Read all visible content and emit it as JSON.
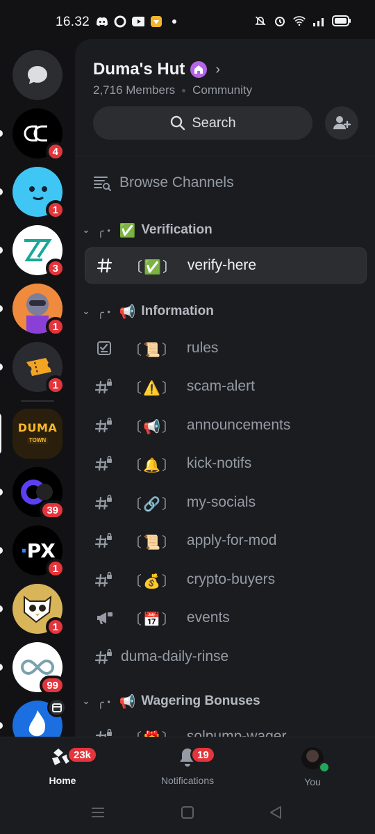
{
  "status_bar": {
    "time": "16.32"
  },
  "servers": [
    {
      "icon": "ac-logo",
      "badge": "4",
      "pill": true,
      "bg": "#000000"
    },
    {
      "icon": "blue-blob",
      "badge": "1",
      "pill": true,
      "bg": "#3fc6f4"
    },
    {
      "icon": "zr-logo",
      "badge": "3",
      "pill": true,
      "bg": "#ffffff"
    },
    {
      "icon": "raccoon-avatar",
      "badge": "1",
      "pill": true,
      "bg": "#f08a3c"
    },
    {
      "icon": "ticket-icon",
      "badge": "1",
      "pill": true,
      "bg": "#2a2b30"
    },
    {
      "icon": "duma-town-logo",
      "badge": "",
      "active": true,
      "bg": "#2a1f0c",
      "logo_text": "DUMA",
      "logo_sub": "TOWN"
    },
    {
      "icon": "ring-logo",
      "badge": "39",
      "pill": true,
      "bg": "#000000"
    },
    {
      "icon": "px-logo",
      "badge": "1",
      "pill": true,
      "bg": "#000000",
      "logo_text": "PX"
    },
    {
      "icon": "owl-logo",
      "badge": "1",
      "pill": true,
      "bg": "#d9b55a"
    },
    {
      "icon": "infinity-logo",
      "badge": "99",
      "pill": true,
      "bg": "#ffffff"
    },
    {
      "icon": "flame-logo",
      "badge": "",
      "pill": true,
      "bg": "#1b6fe0"
    }
  ],
  "server_header": {
    "name": "Duma's Hut",
    "members": "2,716 Members",
    "type": "Community",
    "search_label": "Search"
  },
  "browse_label": "Browse Channels",
  "categories": [
    {
      "deco": "╭・",
      "emoji": "✅",
      "name": "Verification"
    },
    {
      "deco": "╭・",
      "emoji": "📢",
      "name": "Information"
    },
    {
      "deco": "╭・",
      "emoji": "📢",
      "name": "Wagering Bonuses"
    }
  ],
  "channels": [
    {
      "icon": "hash",
      "emoji": "✅",
      "name": "verify-here",
      "active": true
    },
    {
      "icon": "rules",
      "emoji": "📜",
      "name": "rules"
    },
    {
      "icon": "hash-lock",
      "emoji": "⚠️",
      "name": "scam-alert"
    },
    {
      "icon": "hash-lock",
      "emoji": "📢",
      "name": "announcements"
    },
    {
      "icon": "hash-lock",
      "emoji": "🔔",
      "name": "kick-notifs"
    },
    {
      "icon": "hash-lock",
      "emoji": "🔗",
      "name": "my-socials"
    },
    {
      "icon": "hash-lock",
      "emoji": "📜",
      "name": "apply-for-mod"
    },
    {
      "icon": "hash-lock",
      "emoji": "💰",
      "name": "crypto-buyers"
    },
    {
      "icon": "megaphone-lock",
      "emoji": "📅",
      "name": "events"
    },
    {
      "icon": "hash-lock",
      "emoji": "",
      "name": "duma-daily-rinse"
    },
    {
      "icon": "hash-lock",
      "emoji": "🎁",
      "name": "solpump-wager"
    }
  ],
  "bottom_nav": {
    "home": {
      "label": "Home",
      "badge": "23k"
    },
    "notifications": {
      "label": "Notifications",
      "badge": "19"
    },
    "you": {
      "label": "You"
    }
  },
  "colors": {
    "background": "#121214",
    "panel": "#1b1c20",
    "badge": "#e3353c",
    "online": "#23a55a",
    "boost": "#b565e8"
  }
}
